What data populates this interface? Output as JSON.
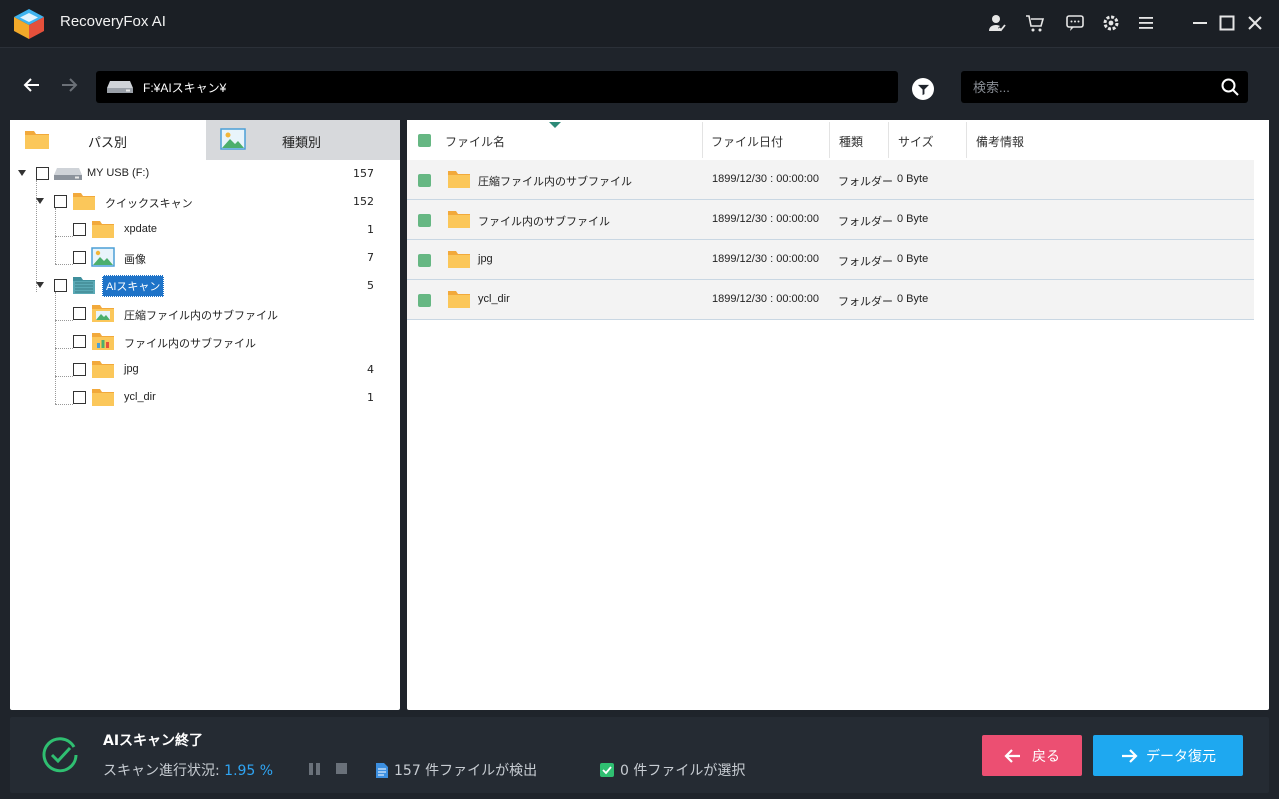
{
  "app": {
    "title": "RecoveryFox AI"
  },
  "nav": {
    "path": "F:¥AIスキャン¥"
  },
  "search": {
    "placeholder": "検索..."
  },
  "tabs": [
    {
      "label": "パス別",
      "icon": "folder-icon"
    },
    {
      "label": "種類別",
      "icon": "image-icon"
    }
  ],
  "tree": [
    {
      "label": "MY USB (F:)",
      "count": "157",
      "icon": "drive-icon"
    },
    {
      "label": "クイックスキャン",
      "count": "152",
      "icon": "folder-icon"
    },
    {
      "label": "xpdate",
      "count": "1",
      "icon": "folder-icon"
    },
    {
      "label": "画像",
      "count": "7",
      "icon": "image-folder-icon"
    },
    {
      "label": "AIスキャン",
      "count": "5",
      "icon": "ai-folder-icon"
    },
    {
      "label": "圧縮ファイル内のサブファイル",
      "count": "",
      "icon": "image-folder-icon"
    },
    {
      "label": "ファイル内のサブファイル",
      "count": "",
      "icon": "chart-folder-icon"
    },
    {
      "label": "jpg",
      "count": "4",
      "icon": "folder-icon"
    },
    {
      "label": "ycl_dir",
      "count": "1",
      "icon": "folder-icon"
    }
  ],
  "table": {
    "headers": [
      "ファイル名",
      "ファイル日付",
      "種類",
      "サイズ",
      "備考情報"
    ],
    "rows": [
      {
        "name": "圧縮ファイル内のサブファイル",
        "date": "1899/12/30 : 00:00:00",
        "type": "フォルダー",
        "size": "0 Byte",
        "note": ""
      },
      {
        "name": "ファイル内のサブファイル",
        "date": "1899/12/30 : 00:00:00",
        "type": "フォルダー",
        "size": "0 Byte",
        "note": ""
      },
      {
        "name": "jpg",
        "date": "1899/12/30 : 00:00:00",
        "type": "フォルダー",
        "size": "0 Byte",
        "note": ""
      },
      {
        "name": "ycl_dir",
        "date": "1899/12/30 : 00:00:00",
        "type": "フォルダー",
        "size": "0 Byte",
        "note": ""
      }
    ]
  },
  "status": {
    "title": "AIスキャン終了",
    "progress_label": "スキャン進行状況:",
    "progress_value": "1.95 %",
    "found_text": "157 件ファイルが検出",
    "selected_text": "0 件ファイルが選択",
    "back_label": "戻る",
    "recover_label": "データ復元"
  },
  "colors": {
    "accent_blue": "#1ea8f0",
    "back_pink": "#ec4f72",
    "checkbox_green": "#66b783",
    "selection_blue": "#1e73c8"
  }
}
